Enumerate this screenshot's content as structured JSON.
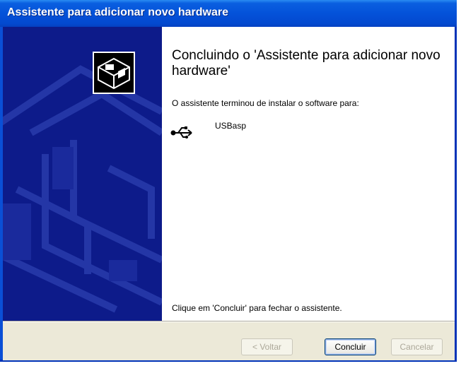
{
  "window": {
    "title": "Assistente para adicionar novo hardware"
  },
  "content": {
    "heading": "Concluindo o 'Assistente para adicionar novo hardware'",
    "description": "O assistente terminou de instalar o software para:",
    "device_name": "USBasp",
    "device_icon": "usb-icon",
    "finish_hint": "Clique em 'Concluir' para fechar o assistente."
  },
  "buttons": {
    "back_label": "< Voltar",
    "finish_label": "Concluir",
    "cancel_label": "Cancelar"
  },
  "colors": {
    "titlebar": "#0452d9",
    "sidebar": "#0d1b8a",
    "footer": "#ece9d8"
  }
}
